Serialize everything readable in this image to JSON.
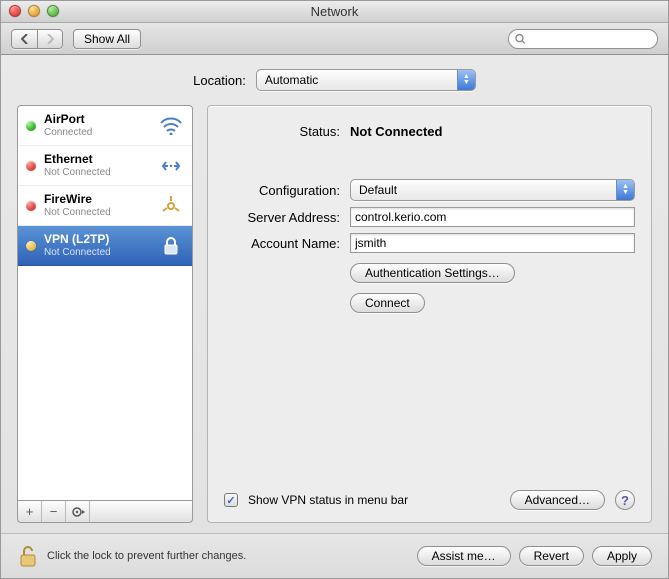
{
  "window": {
    "title": "Network"
  },
  "toolbar": {
    "show_all_label": "Show All",
    "search_placeholder": ""
  },
  "location": {
    "label": "Location:",
    "value": "Automatic"
  },
  "sidebar": {
    "items": [
      {
        "title": "AirPort",
        "subtitle": "Connected",
        "status": "green",
        "icon": "wifi-icon",
        "selected": false
      },
      {
        "title": "Ethernet",
        "subtitle": "Not Connected",
        "status": "red",
        "icon": "ethernet-icon",
        "selected": false
      },
      {
        "title": "FireWire",
        "subtitle": "Not Connected",
        "status": "red",
        "icon": "firewire-icon",
        "selected": false
      },
      {
        "title": "VPN (L2TP)",
        "subtitle": "Not Connected",
        "status": "yellow",
        "icon": "lock-icon",
        "selected": true
      }
    ]
  },
  "pane": {
    "status_label": "Status:",
    "status_value": "Not Connected",
    "configuration_label": "Configuration:",
    "configuration_value": "Default",
    "server_label": "Server Address:",
    "server_value": "control.kerio.com",
    "account_label": "Account Name:",
    "account_value": "jsmith",
    "auth_settings_btn": "Authentication Settings…",
    "connect_btn": "Connect",
    "show_status_label": "Show VPN status in menu bar",
    "show_status_checked": true,
    "advanced_btn": "Advanced…"
  },
  "bottom": {
    "lock_text": "Click the lock to prevent further changes.",
    "assist_btn": "Assist me…",
    "revert_btn": "Revert",
    "apply_btn": "Apply"
  }
}
